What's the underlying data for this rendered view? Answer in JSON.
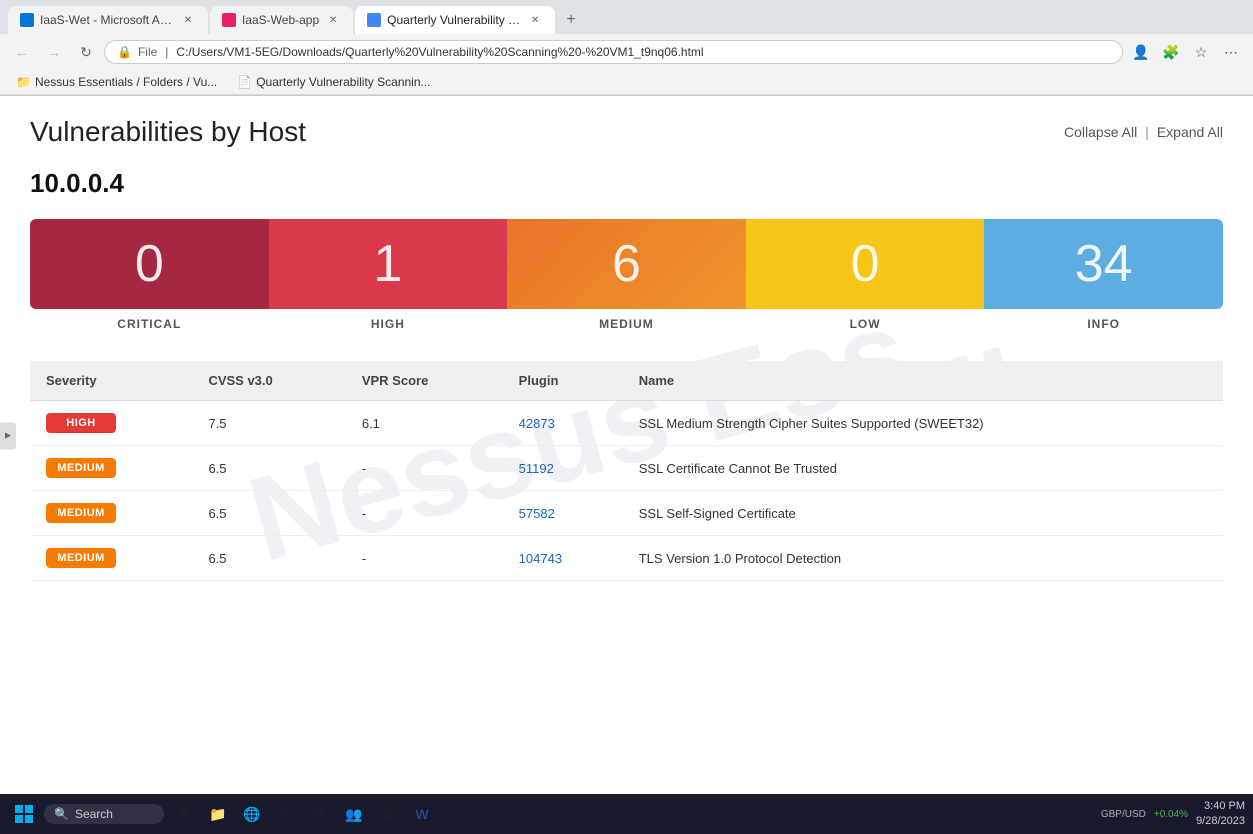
{
  "browser": {
    "tabs": [
      {
        "id": "tab1",
        "title": "IaaS-Wet - Microsoft Azure",
        "active": false,
        "favicon": "A"
      },
      {
        "id": "tab2",
        "title": "IaaS-Web-app",
        "active": false,
        "favicon": "I"
      },
      {
        "id": "tab3",
        "title": "Quarterly Vulnerability Scannin...",
        "active": true,
        "favicon": "Q"
      }
    ],
    "address": "C:/Users/VM1-5EG/Downloads/Quarterly%20Vulnerability%20Scanning%20-%20VM1_t9nq06.html",
    "address_prefix": "File",
    "bookmark_items": [
      {
        "label": "Nessus Essentials / Folders / Vu..."
      },
      {
        "label": "Quarterly Vulnerability Scannin..."
      }
    ]
  },
  "page": {
    "title": "Vulnerabilities by Host",
    "collapse_all": "Collapse All",
    "expand_all": "Expand All",
    "divider": "|"
  },
  "host": {
    "ip": "10.0.0.4",
    "scores": [
      {
        "value": "0",
        "label": "CRITICAL",
        "color_start": "#a52842",
        "color_end": "#a52842"
      },
      {
        "value": "1",
        "label": "HIGH",
        "color_start": "#d9394a",
        "color_end": "#d9394a"
      },
      {
        "value": "6",
        "label": "MEDIUM",
        "color_start": "#e8742a",
        "color_end": "#e8742a"
      },
      {
        "value": "0",
        "label": "LOW",
        "color_start": "#f5c518",
        "color_end": "#f5c518"
      },
      {
        "value": "34",
        "label": "INFO",
        "color_start": "#5dade2",
        "color_end": "#5dade2"
      }
    ]
  },
  "table": {
    "headers": [
      "Severity",
      "CVSS v3.0",
      "VPR Score",
      "Plugin",
      "Name"
    ],
    "rows": [
      {
        "severity": "HIGH",
        "severity_class": "severity-high",
        "cvss": "7.5",
        "vpr": "6.1",
        "plugin": "42873",
        "name": "SSL Medium Strength Cipher Suites Supported (SWEET32)"
      },
      {
        "severity": "MEDIUM",
        "severity_class": "severity-medium",
        "cvss": "6.5",
        "vpr": "-",
        "plugin": "51192",
        "name": "SSL Certificate Cannot Be Trusted"
      },
      {
        "severity": "MEDIUM",
        "severity_class": "severity-medium",
        "cvss": "6.5",
        "vpr": "-",
        "plugin": "57582",
        "name": "SSL Self-Signed Certificate"
      },
      {
        "severity": "MEDIUM",
        "severity_class": "severity-medium",
        "cvss": "6.5",
        "vpr": "-",
        "plugin": "104743",
        "name": "TLS Version 1.0 Protocol Detection"
      }
    ]
  },
  "taskbar": {
    "search_placeholder": "Search",
    "time": "3:40 PM",
    "date": "9/28/2023",
    "currency": "GBP/USD",
    "currency_value": "+0.04%"
  },
  "watermark_text": "Nessus Ess..."
}
